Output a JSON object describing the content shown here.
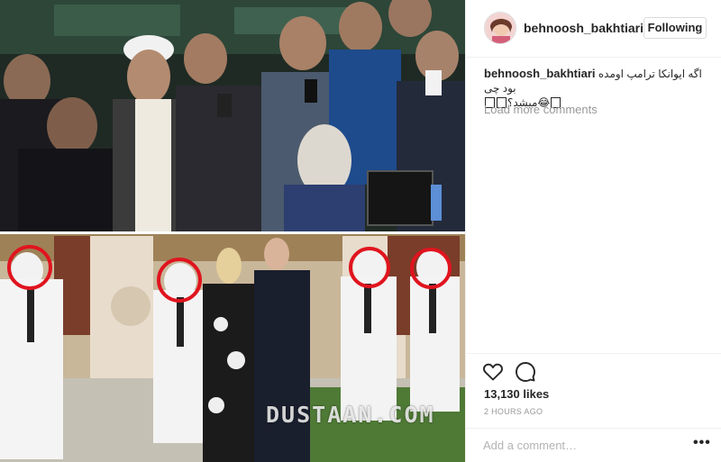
{
  "post": {
    "username": "behnoosh_bakhtiari",
    "follow_label": "Following",
    "caption_user": "behnoosh_bakhtiari",
    "caption_text": "اگه ایوانکا ترامپ اومده بود چی",
    "caption_text2": "میشد؟😂",
    "load_more": "Load more comments",
    "likes": "13,130 likes",
    "time_ago": "2 HOURS AGO",
    "comment_placeholder": "Add a comment…",
    "more_label": "•••",
    "watermark": "DUSTAAN.COM"
  },
  "icons": {
    "like": "heart-outline-icon",
    "comment": "comment-bubble-icon",
    "more": "more-options-icon"
  },
  "colors": {
    "text": "#262626",
    "muted": "#999999",
    "border": "#dbdbdb",
    "highlight_circle": "#e0141e"
  }
}
